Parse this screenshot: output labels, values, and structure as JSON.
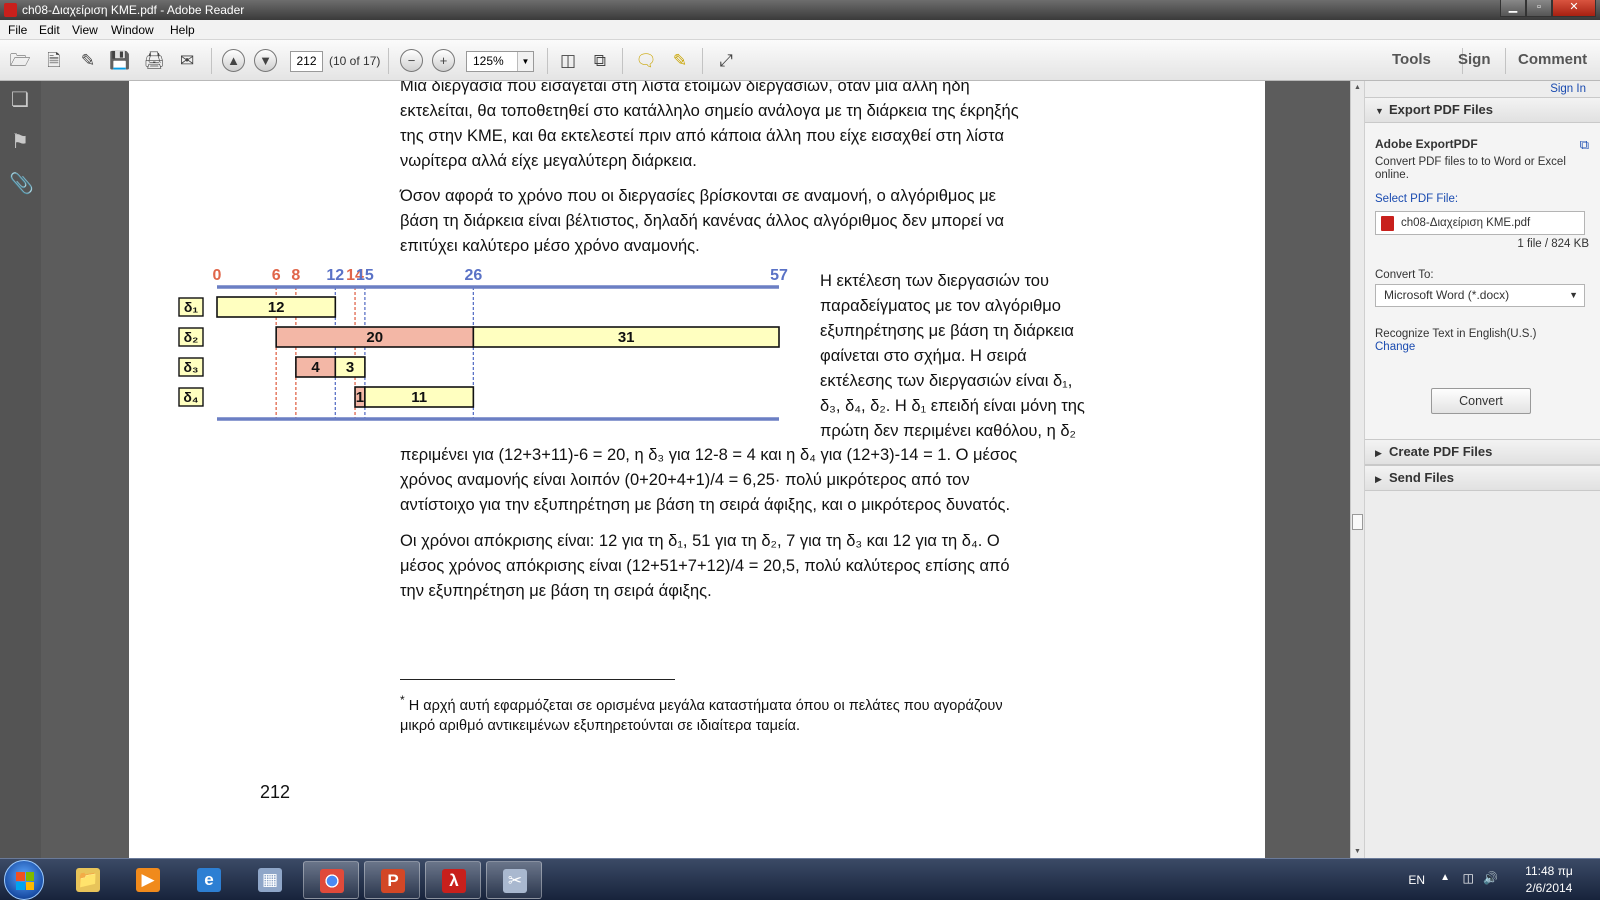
{
  "window": {
    "title": "ch08-Διαχείριση ΚΜΕ.pdf - Adobe Reader",
    "minimize": "▁",
    "maximize": "▫",
    "close": "✕"
  },
  "menu": [
    "File",
    "Edit",
    "View",
    "Window",
    "Help"
  ],
  "toolbar": {
    "page_current": "212",
    "page_of": "(10 of 17)",
    "zoom": "125%",
    "tools_label": "Tools",
    "sign_label": "Sign",
    "comment_label": "Comment"
  },
  "document": {
    "paragraphs": [
      [
        "Μια διεργασία που εισάγεται στη λίστα έτοιμων διεργασιών, όταν μια άλλη ήδη",
        "εκτελείται, θα τοποθετηθεί στο κατάλληλο σημείο ανάλογα με τη διάρκεια της έκρηξής",
        "της στην ΚΜΕ, και θα εκτελεστεί πριν από κάποια άλλη που είχε εισαχθεί στη λίστα",
        "νωρίτερα αλλά είχε μεγαλύτερη διάρκεια."
      ],
      [
        "Όσον αφορά το χρόνο που οι διεργασίες βρίσκονται σε αναμονή, ο αλγόριθμος με",
        "βάση τη διάρκεια είναι βέλτιστος, δηλαδή κανένας άλλος αλγόριθμος δεν μπορεί να",
        "επιτύχει καλύτερο μέσο χρόνο αναμονής."
      ]
    ],
    "side_paragraph": [
      "Η εκτέλεση των διεργασιών του",
      "παραδείγματος με τον αλγόριθμο",
      "εξυπηρέτησης με βάση τη διάρκεια",
      "φαίνεται στο σχήμα. Η σειρά",
      "εκτέλεσης των διεργασιών είναι δ₁,",
      "δ₃, δ₄, δ₂. Η δ₁ επειδή είναι μόνη της",
      "πρώτη δεν περιμένει καθόλου, η δ₂"
    ],
    "continuation": [
      "περιμένει για (12+3+11)-6 = 20, η δ₃ για 12-8 = 4 και η δ₄ για (12+3)-14 = 1. Ο μέσος",
      "χρόνος αναμονής είναι λοιπόν (0+20+4+1)/4 = 6,25· πολύ μικρότερος από τον",
      "αντίστοιχο για την εξυπηρέτηση με βάση τη σειρά άφιξης, και ο μικρότερος δυνατός."
    ],
    "response": [
      "Οι χρόνοι απόκρισης είναι: 12 για τη δ₁, 51 για τη δ₂, 7 για τη δ₃ και 12 για τη δ₄. Ο",
      "μέσος χρόνος απόκρισης είναι (12+51+7+12)/4 = 20,5, πολύ καλύτερος επίσης από",
      "την εξυπηρέτηση με βάση τη σειρά άφιξης."
    ],
    "footnote_mark": "*",
    "footnote": [
      "Η αρχή αυτή εφαρμόζεται σε ορισμένα μεγάλα καταστήματα όπου οι πελάτες που αγοράζουν",
      "μικρό αριθμό αντικειμένων εξυπηρετούνται σε ιδιαίτερα ταμεία."
    ],
    "page_number": "212"
  },
  "chart_data": {
    "type": "gantt",
    "time_ticks": [
      {
        "t": 0,
        "label": "0",
        "kind": "arrival"
      },
      {
        "t": 6,
        "label": "6",
        "kind": "arrival"
      },
      {
        "t": 8,
        "label": "8",
        "kind": "arrival"
      },
      {
        "t": 12,
        "label": "12",
        "kind": "schedule"
      },
      {
        "t": 14,
        "label": "14",
        "kind": "arrival"
      },
      {
        "t": 15,
        "label": "15",
        "kind": "schedule"
      },
      {
        "t": 26,
        "label": "26",
        "kind": "schedule"
      },
      {
        "t": 57,
        "label": "57",
        "kind": "schedule"
      }
    ],
    "xlim": [
      0,
      57
    ],
    "rows": [
      {
        "label": "δ₁",
        "segments": [
          {
            "start": 0,
            "end": 12,
            "label": "12",
            "state": "run"
          }
        ]
      },
      {
        "label": "δ₂",
        "segments": [
          {
            "start": 6,
            "end": 26,
            "label": "20",
            "state": "wait"
          },
          {
            "start": 26,
            "end": 57,
            "label": "31",
            "state": "run"
          }
        ]
      },
      {
        "label": "δ₃",
        "segments": [
          {
            "start": 8,
            "end": 12,
            "label": "4",
            "state": "wait"
          },
          {
            "start": 12,
            "end": 15,
            "label": "3",
            "state": "run"
          }
        ]
      },
      {
        "label": "δ₄",
        "segments": [
          {
            "start": 14,
            "end": 15,
            "label": "1",
            "state": "wait"
          },
          {
            "start": 15,
            "end": 26,
            "label": "11",
            "state": "run"
          }
        ]
      }
    ],
    "colors": {
      "run": "#ffffc0",
      "wait": "#f3b7a6",
      "arrival": "#e0664a",
      "schedule": "#5a72c6",
      "axis": "#6b7fc4"
    }
  },
  "right_pane": {
    "sign_in": "Sign In",
    "export_header": "Export PDF Files",
    "export_title": "Adobe ExportPDF",
    "export_desc": [
      "Convert PDF files to to Word or Excel",
      "online."
    ],
    "select_label": "Select PDF File:",
    "file_name": "ch08-Διαχείριση ΚΜΕ.pdf",
    "file_info": "1 file / 824 KB",
    "convert_to_label": "Convert To:",
    "convert_to_value": "Microsoft Word (*.docx)",
    "recognize_text": "Recognize Text in English(U.S.)",
    "change_link": "Change",
    "convert_button": "Convert",
    "create_header": "Create PDF Files",
    "send_header": "Send Files"
  },
  "taskbar": {
    "language": "EN",
    "time": "11:48 πμ",
    "date": "2/6/2014"
  }
}
